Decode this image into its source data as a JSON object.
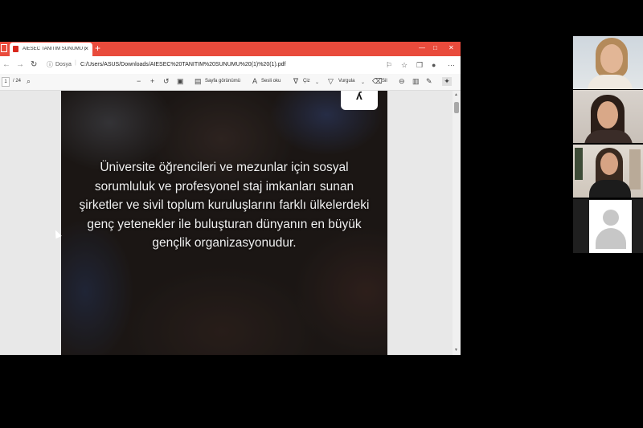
{
  "browser": {
    "tab_title": "AIESEC TANITIM SUNUMU (1) (",
    "address_label": "Dosya",
    "url": "C:/Users/ASUS/Downloads/AIESEC%20TANITIM%20SUNUMU%20(1)%20(1).pdf"
  },
  "pdf_toolbar": {
    "page_number": "1",
    "page_total": "/ 24",
    "page_view_label": "Sayfa görünümü",
    "read_aloud_label": "Sesli oku",
    "draw_label": "Çiz",
    "highlight_label": "Vurgula",
    "erase_label": "Sil"
  },
  "slide": {
    "lines": [
      "Üniversite öğrencileri ve mezunlar için sosyal",
      "sorumluluk ve profesyonel staj imkanları sunan",
      "şirketler ve sivil toplum kuruluşlarını farklı ülkelerdeki",
      "genç yetenekler ile buluşturan dünyanın en büyük",
      "gençlik organizasyonudur."
    ]
  }
}
